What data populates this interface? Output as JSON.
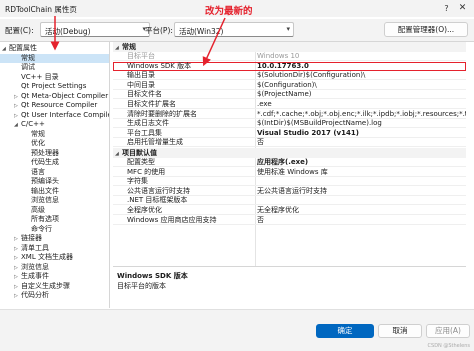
{
  "window": {
    "title": "RDToolChain 属性页",
    "help": "?",
    "close": "✕"
  },
  "annotation": "改为最新的",
  "config": {
    "config_label": "配置(C):",
    "config_value": "活动(Debug)",
    "platform_label": "平台(P):",
    "platform_value": "活动(Win32)",
    "manager_button": "配置管理器(O)..."
  },
  "tree": [
    {
      "label": "配置属性",
      "level": 0,
      "expanded": true
    },
    {
      "label": "常规",
      "level": 1,
      "selected": true
    },
    {
      "label": "调试",
      "level": 1
    },
    {
      "label": "VC++ 目录",
      "level": 1
    },
    {
      "label": "Qt Project Settings",
      "level": 1
    },
    {
      "label": "Qt Meta-Object Compiler",
      "level": 1,
      "collapsed": true
    },
    {
      "label": "Qt Resource Compiler",
      "level": 1,
      "collapsed": true
    },
    {
      "label": "Qt User Interface Compiler",
      "level": 1,
      "collapsed": true
    },
    {
      "label": "C/C++",
      "level": 1,
      "expanded": true
    },
    {
      "label": "常规",
      "level": 2
    },
    {
      "label": "优化",
      "level": 2
    },
    {
      "label": "预处理器",
      "level": 2
    },
    {
      "label": "代码生成",
      "level": 2
    },
    {
      "label": "语言",
      "level": 2
    },
    {
      "label": "预编译头",
      "level": 2
    },
    {
      "label": "输出文件",
      "level": 2
    },
    {
      "label": "浏览信息",
      "level": 2
    },
    {
      "label": "高级",
      "level": 2
    },
    {
      "label": "所有选项",
      "level": 2
    },
    {
      "label": "命令行",
      "level": 2
    },
    {
      "label": "链接器",
      "level": 1,
      "collapsed": true
    },
    {
      "label": "清单工具",
      "level": 1,
      "collapsed": true
    },
    {
      "label": "XML 文档生成器",
      "level": 1,
      "collapsed": true
    },
    {
      "label": "浏览信息",
      "level": 1,
      "collapsed": true
    },
    {
      "label": "生成事件",
      "level": 1,
      "collapsed": true
    },
    {
      "label": "自定义生成步骤",
      "level": 1,
      "collapsed": true
    },
    {
      "label": "代码分析",
      "level": 1,
      "collapsed": true
    }
  ],
  "sections": [
    {
      "title": "常规",
      "rows": [
        {
          "name": "目标平台",
          "value": "Windows 10",
          "dim": true
        },
        {
          "name": "Windows SDK 版本",
          "value": "10.0.17763.0",
          "bold": true,
          "boxed": true
        },
        {
          "name": "输出目录",
          "value": "$(SolutionDir)$(Configuration)\\"
        },
        {
          "name": "中间目录",
          "value": "$(Configuration)\\"
        },
        {
          "name": "目标文件名",
          "value": "$(ProjectName)"
        },
        {
          "name": "目标文件扩展名",
          "value": ".exe"
        },
        {
          "name": "清除时要删除的扩展名",
          "value": "*.cdf;*.cache;*.obj;*.obj.enc;*.ilk;*.ipdb;*.iobj;*.resources;*.tlb;*.tli;"
        },
        {
          "name": "生成日志文件",
          "value": "$(IntDir)$(MSBuildProjectName).log"
        },
        {
          "name": "平台工具集",
          "value": "Visual Studio 2017 (v141)",
          "bold": true
        },
        {
          "name": "启用托管增量生成",
          "value": "否"
        }
      ]
    },
    {
      "title": "项目默认值",
      "rows": [
        {
          "name": "配置类型",
          "value": "应用程序(.exe)",
          "bold": true
        },
        {
          "name": "MFC 的使用",
          "value": "使用标准 Windows 库"
        },
        {
          "name": "字符集",
          "value": ""
        },
        {
          "name": "公共语言运行时支持",
          "value": "无公共语言运行时支持"
        },
        {
          "name": ".NET 目标框架版本",
          "value": ""
        },
        {
          "name": "全程序优化",
          "value": "无全程序优化"
        },
        {
          "name": "Windows 应用商店应用支持",
          "value": "否"
        }
      ]
    }
  ],
  "description": {
    "title": "Windows SDK 版本",
    "text": "目标平台的版本"
  },
  "footer": {
    "ok": "确定",
    "cancel": "取消",
    "apply": "应用(A)",
    "watermark": "CSDN @Sthelens"
  }
}
